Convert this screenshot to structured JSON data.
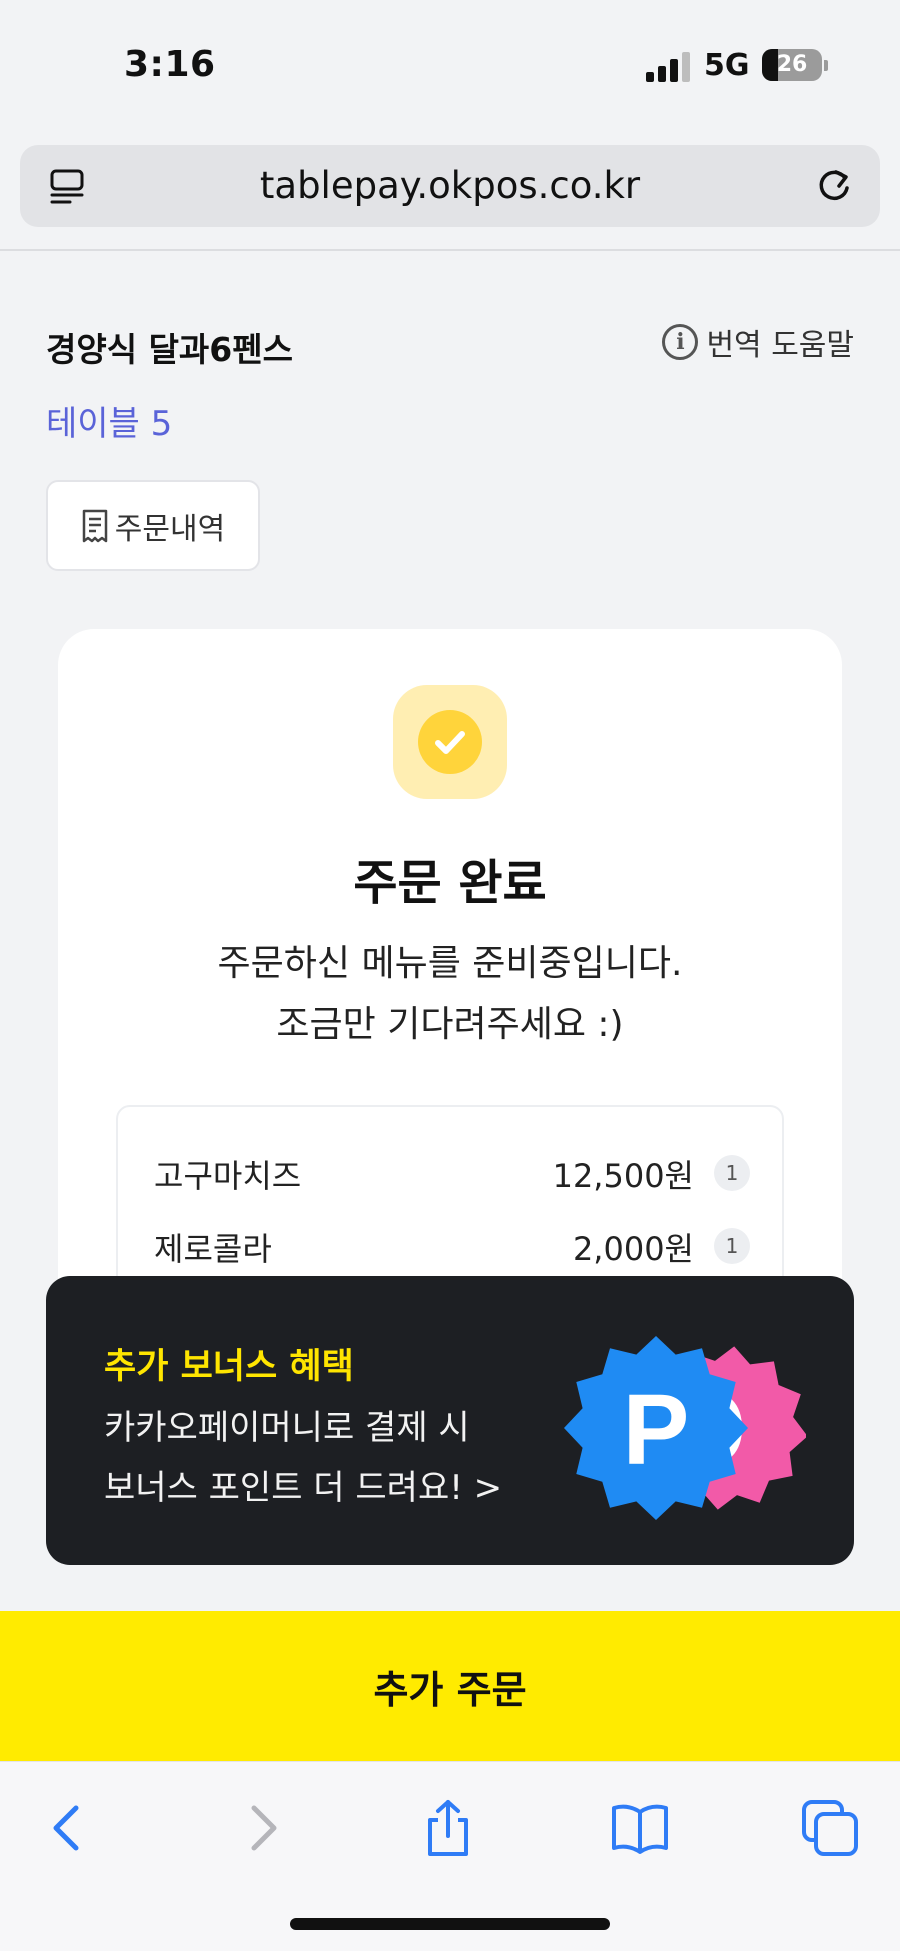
{
  "status_bar": {
    "time": "3:16",
    "network": "5G",
    "battery": "26",
    "battery_fraction": 0.26
  },
  "browser": {
    "url": "tablepay.okpos.co.kr"
  },
  "header": {
    "store_name": "경양식 달과6펜스",
    "translate_help": "번역 도움말",
    "table_label": "테이블 5",
    "order_history_label": "주문내역"
  },
  "order_complete": {
    "title": "주문 완료",
    "message_line1": "주문하신 메뉴를 준비중입니다.",
    "message_line2": "조금만 기다려주세요 :)",
    "items": [
      {
        "name": "고구마치즈",
        "price": "12,500원",
        "qty": "1"
      },
      {
        "name": "제로콜라",
        "price": "2,000원",
        "qty": "1"
      }
    ]
  },
  "promo": {
    "title": "추가 보너스 혜택",
    "line1": "카카오페이머니로 결제 시",
    "line2": "보너스 포인트 더 드려요! >",
    "logo_letter": "P",
    "colors": {
      "blue": "#1f8bf3",
      "pink": "#f25aa8",
      "title": "#ffe500"
    }
  },
  "cta": {
    "label": "추가 주문",
    "color": "#ffeb00"
  },
  "toolbar": {
    "icons": [
      "back-icon",
      "forward-icon",
      "share-icon",
      "bookmarks-icon",
      "tabs-icon"
    ]
  },
  "colors": {
    "accent": "#5a63d8",
    "check": "#ffd43b"
  }
}
